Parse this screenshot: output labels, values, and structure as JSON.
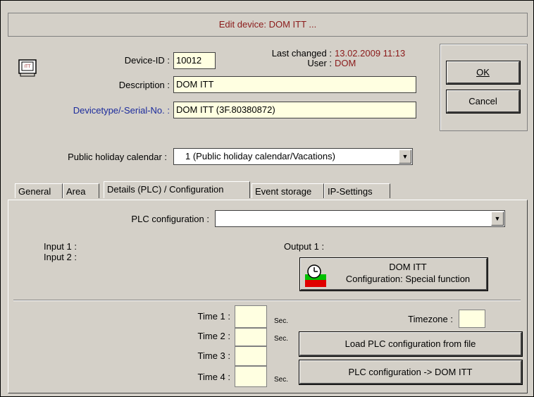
{
  "title": "Edit device: DOM ITT ...",
  "device_icon_text": "ITT",
  "labels": {
    "device_id": "Device-ID :",
    "description": "Description :",
    "devicetype": "Devicetype/-Serial-No. :",
    "last_changed": "Last changed :",
    "user": "User :",
    "public_holiday": "Public holiday calendar :"
  },
  "values": {
    "device_id": "10012",
    "description": "DOM ITT",
    "devicetype": "DOM ITT (3F.80380872)",
    "last_changed": "13.02.2009 11:13",
    "user": "DOM",
    "public_holiday": "1 (Public holiday calendar/Vacations)"
  },
  "buttons": {
    "ok": "OK",
    "cancel": "Cancel"
  },
  "tabs": [
    "General",
    "Area",
    "Details (PLC) / Configuration",
    "Event storage",
    "IP-Settings"
  ],
  "active_tab": 2,
  "plc": {
    "config_label": "PLC configuration :",
    "config_value": "",
    "input1": "Input 1 :",
    "input2": "Input 2 :",
    "output1": "Output 1 :",
    "special_button_line1": "DOM ITT",
    "special_button_line2": "Configuration: Special function",
    "time1": "Time 1 :",
    "time2": "Time 2 :",
    "time3": "Time 3 :",
    "time4": "Time 4 :",
    "sec": "Sec.",
    "timezone": "Timezone :",
    "load_button": "Load PLC configuration from file",
    "transfer_button": "PLC configuration -> DOM ITT"
  },
  "colors": {
    "dialog_bg": "#d4d0c8",
    "title_text": "#8b1a1a",
    "field_bg": "#ffffe1",
    "label_blue": "#1c2b9c",
    "icon_green": "#00c000",
    "icon_red": "#e00000"
  },
  "icons": {
    "device": "terminal-monitor-icon",
    "special_function": "clock-timer-icon",
    "dropdown": "chevron-down-icon"
  }
}
